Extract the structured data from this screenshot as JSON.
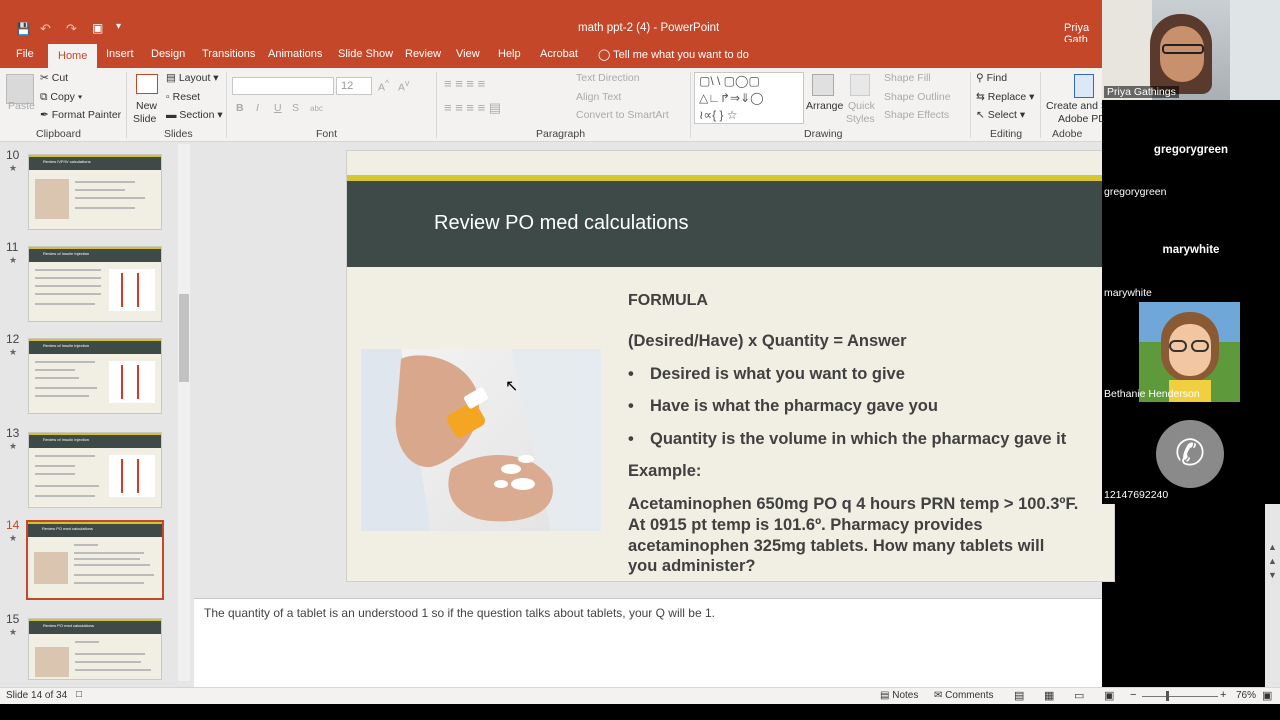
{
  "titlebar": {
    "title": "math ppt-2 (4)  -  PowerPoint",
    "user": "Priya Gath",
    "quick_access": [
      "save-icon",
      "undo-icon",
      "redo-icon",
      "start-icon",
      "customize-icon"
    ]
  },
  "tabs": [
    "File",
    "Home",
    "Insert",
    "Design",
    "Transitions",
    "Animations",
    "Slide Show",
    "Review",
    "View",
    "Help",
    "Acrobat"
  ],
  "tell_me": "Tell me what you want to do",
  "ribbon": {
    "clipboard": {
      "paste": "Paste",
      "cut": "Cut",
      "copy": "Copy",
      "format_painter": "Format Painter",
      "label": "Clipboard"
    },
    "slides": {
      "new_slide_1": "New",
      "new_slide_2": "Slide",
      "layout": "Layout",
      "reset": "Reset",
      "section": "Section",
      "label": "Slides"
    },
    "font": {
      "size": "12",
      "bold": "B",
      "italic": "I",
      "underline": "U",
      "strike": "S",
      "abc": "abc",
      "label": "Font"
    },
    "paragraph": {
      "text_direction": "Text Direction",
      "align_text": "Align Text",
      "smartart": "Convert to SmartArt",
      "label": "Paragraph"
    },
    "drawing": {
      "arrange": "Arrange",
      "quick_styles_1": "Quick",
      "quick_styles_2": "Styles",
      "shape_fill": "Shape Fill",
      "shape_outline": "Shape Outline",
      "shape_effects": "Shape Effects",
      "label": "Drawing"
    },
    "editing": {
      "find": "Find",
      "replace": "Replace",
      "select": "Select",
      "label": "Editing"
    },
    "acrobat": {
      "create_1": "Create and S",
      "create_2": "Adobe PD",
      "label": "Adobe Acro"
    }
  },
  "thumbnails": [
    {
      "num": "10",
      "title": "Review IVP/IV calculations"
    },
    {
      "num": "11",
      "title": "Review of Insulin Injection"
    },
    {
      "num": "12",
      "title": "Review of Insulin injection"
    },
    {
      "num": "13",
      "title": "Review of Insulin injection"
    },
    {
      "num": "14",
      "title": "Review PO med calculations"
    },
    {
      "num": "15",
      "title": "Review PO med calculations"
    }
  ],
  "slide": {
    "title": "Review PO med calculations",
    "formula_heading": "FORMULA",
    "formula": "(Desired/Have) x Quantity = Answer",
    "bullets": [
      "Desired is what you want to give",
      "Have is what the pharmacy gave you",
      "Quantity is the volume in which the pharmacy gave it"
    ],
    "example_label": "Example:",
    "example_lines": [
      "Acetaminophen 650mg PO q 4 hours PRN temp > 100.3ºF.",
      "At 0915 pt temp is 101.6º. Pharmacy provides",
      "acetaminophen 325mg tablets.  How many tablets will",
      "you administer?"
    ]
  },
  "notes": "The quantity of a tablet is an understood 1 so if the question talks about tablets, your Q will be 1.",
  "status": {
    "slide_of": "Slide 14 of 34",
    "notes": "Notes",
    "comments": "Comments",
    "zoom": "76%"
  },
  "video": {
    "presenter": "Priya Gathings",
    "participants": [
      {
        "big": "gregorygreen",
        "small": "gregorygreen"
      },
      {
        "big": "marywhite",
        "small": "marywhite"
      }
    ],
    "bethanie": "Bethanie Henderson",
    "phone": "12147692240"
  }
}
